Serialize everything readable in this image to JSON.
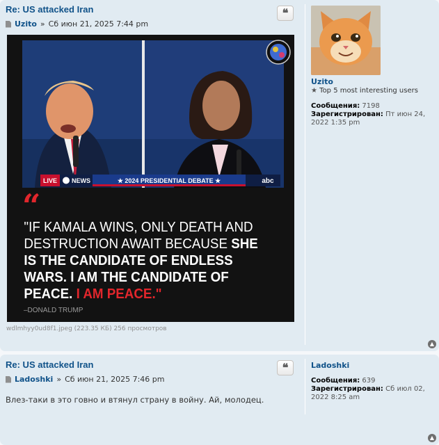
{
  "posts": [
    {
      "title": "Re: US attacked Iran",
      "author": "Uzito",
      "sep": "»",
      "date": "Сб июн 21, 2025 7:44 pm",
      "quote_icon": "quote-icon",
      "attachment": {
        "image_text": {
          "live": "LIVE",
          "news": "NEWS",
          "debate_banner": "★ 2024 PRESIDENTIAL DEBATE ★",
          "network": "abc",
          "quote_mark": "“",
          "quote_line1": "\"IF KAMALA WINS, ONLY DEATH AND",
          "quote_line2a": "DESTRUCTION AWAIT BECAUSE ",
          "quote_line2b": "SHE",
          "quote_line3": "IS THE CANDIDATE OF ENDLESS",
          "quote_line4": "WARS. I AM THE CANDIDATE OF",
          "quote_line5a": "PEACE. ",
          "quote_line5b": "I AM PEACE.\"",
          "attribution": "–DONALD TRUMP"
        },
        "caption": "wdlmhyy0ud8f1.jpeg (223.35 КБ) 256 просмотров"
      },
      "profile": {
        "name": "Uzito",
        "rank": "Top 5 most interesting users",
        "posts_label": "Сообщения:",
        "posts_value": "7198",
        "reg_label": "Зарегистрирован:",
        "reg_value": "Пт июн 24, 2022 1:35 pm"
      }
    },
    {
      "title": "Re: US attacked Iran",
      "author": "Ladoshki",
      "sep": "»",
      "date": "Сб июн 21, 2025 7:46 pm",
      "content": "Влез-таки в это говно и втянул страну в войну. Ай, молодец.",
      "profile": {
        "name": "Ladoshki",
        "posts_label": "Сообщения:",
        "posts_value": "639",
        "reg_label": "Зарегистрирован:",
        "reg_value": "Сб июл 02, 2022 8:25 am"
      }
    }
  ],
  "colors": {
    "link": "#105289",
    "post_bg": "#e1ebf2",
    "quote_red": "#e1262c"
  }
}
